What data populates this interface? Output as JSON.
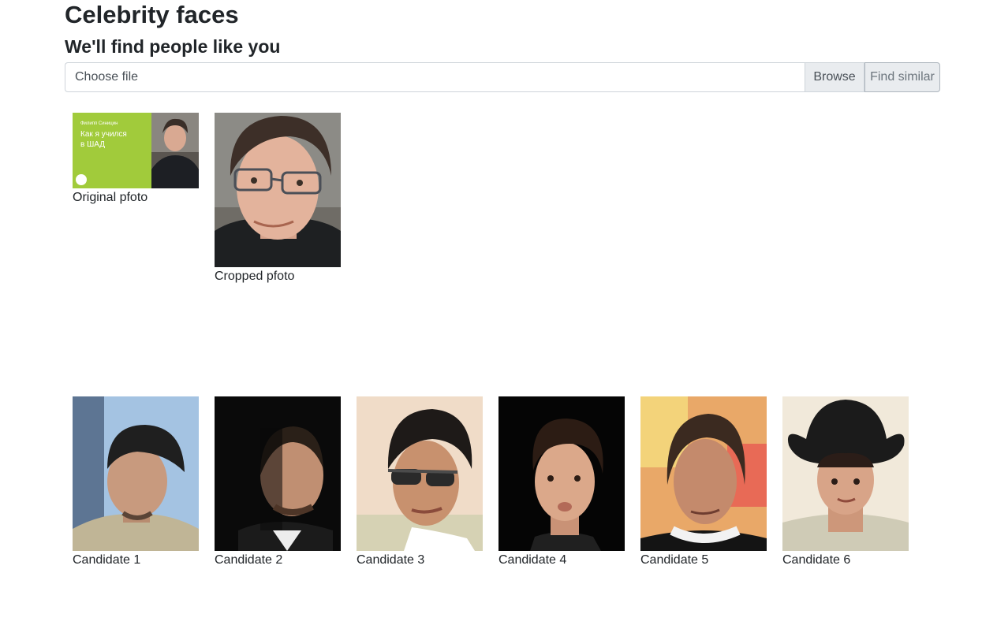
{
  "page": {
    "title": "Celebrity faces",
    "subtitle": "We'll find people like you"
  },
  "upload": {
    "file_placeholder": "Choose file",
    "browse_label": "Browse",
    "find_label": "Find similar"
  },
  "photos": {
    "original": {
      "caption": "Original pfoto",
      "overlay_name": "Филипп Синицин",
      "overlay_title_line1": "Как я учился",
      "overlay_title_line2": "в ШАД"
    },
    "cropped": {
      "caption": "Cropped pfoto"
    }
  },
  "candidates": [
    {
      "caption": "Candidate 1"
    },
    {
      "caption": "Candidate 2"
    },
    {
      "caption": "Candidate 3"
    },
    {
      "caption": "Candidate 4"
    },
    {
      "caption": "Candidate 5"
    },
    {
      "caption": "Candidate 6"
    }
  ],
  "colors": {
    "original_green": "#a1cb3b",
    "button_bg": "#e9ecef"
  }
}
